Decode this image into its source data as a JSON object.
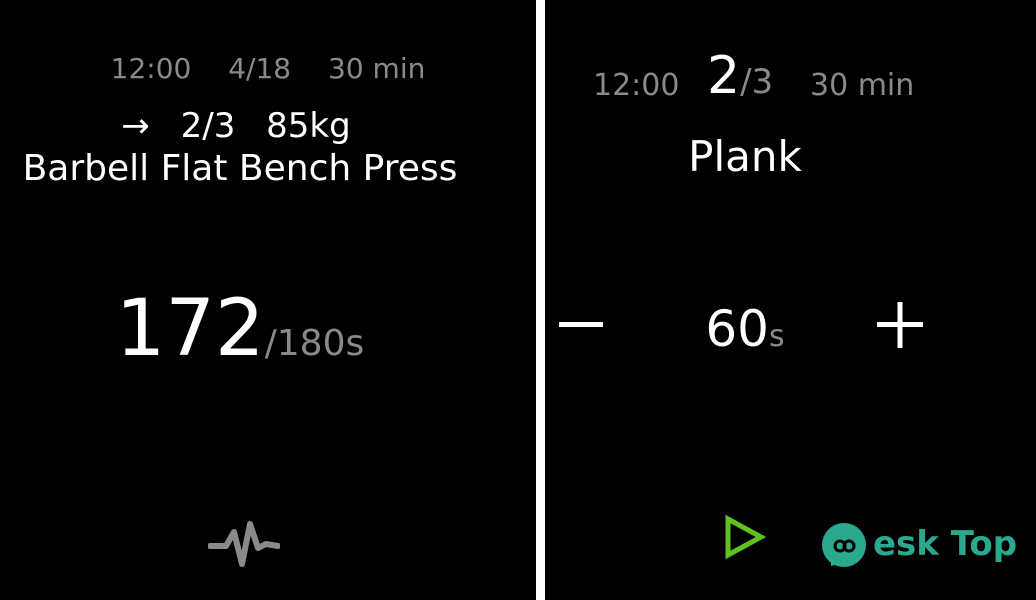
{
  "left": {
    "status": {
      "time": "12:00",
      "date": "4/18",
      "duration": "30 min"
    },
    "set_line": {
      "arrow": "→",
      "set": "2/3",
      "weight": "85kg"
    },
    "exercise": "Barbell Flat Bench Press",
    "timer": {
      "current": "172",
      "total": "/180s"
    },
    "icon": "pulse-icon"
  },
  "right": {
    "status": {
      "time": "12:00",
      "set_current": "2",
      "set_total": "/3",
      "duration": "30 min"
    },
    "exercise": "Plank",
    "duration": {
      "value": "60",
      "unit": "s"
    },
    "icons": {
      "minus": "minus-icon",
      "plus": "plus-icon",
      "play": "play-icon"
    }
  },
  "watermark": {
    "text": "esk Top"
  },
  "colors": {
    "background": "#000000",
    "text_primary": "#ffffff",
    "text_secondary": "#8a8a8a",
    "accent_green": "#5ec21f",
    "watermark": "#2ba98f",
    "divider": "#ffffff"
  }
}
